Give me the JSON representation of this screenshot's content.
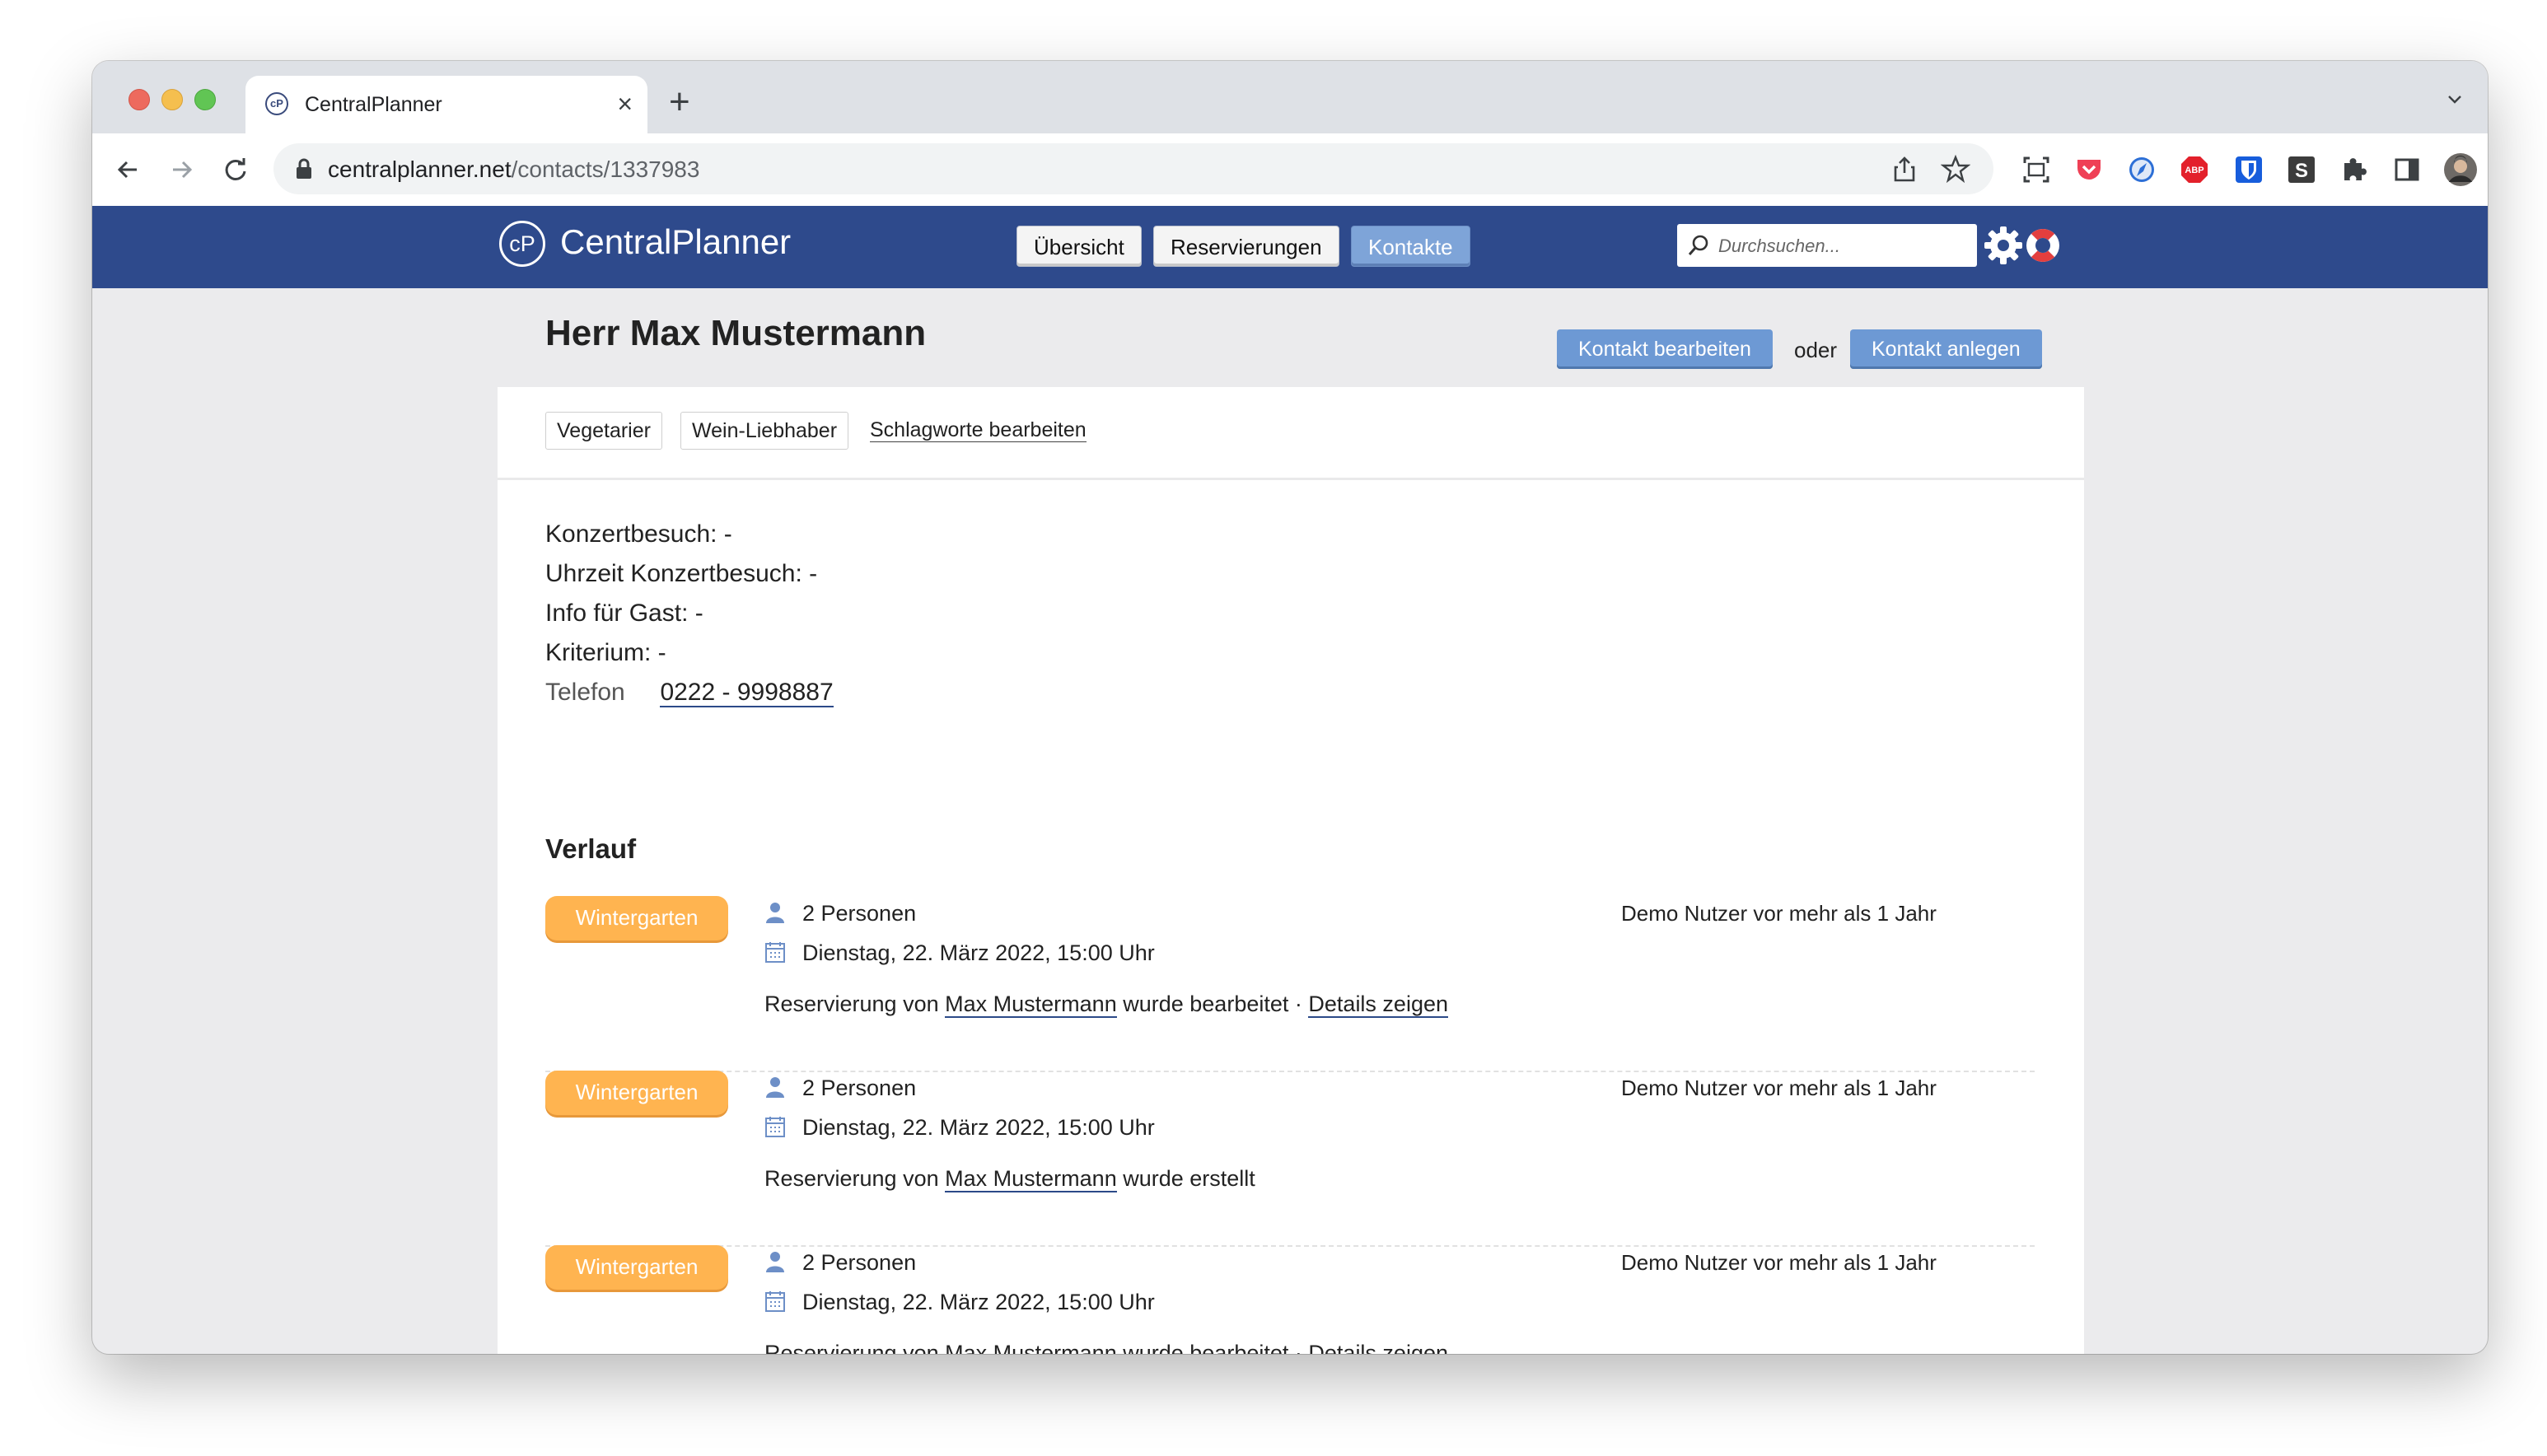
{
  "browser": {
    "tab_title": "CentralPlanner",
    "tab_favicon": "cP",
    "url_host": "centralplanner.net",
    "url_path": "/contacts/1337983",
    "extensions": [
      "share-icon",
      "bookmark-star-icon",
      "screenshot-icon",
      "pocket-icon",
      "safari-icon",
      "adblock-icon",
      "bitwarden-icon",
      "s-extension-icon",
      "puzzle-icon",
      "sidebar-icon",
      "profile-avatar",
      "more-vert-icon"
    ]
  },
  "app": {
    "logo_mark": "cP",
    "name": "CentralPlanner",
    "nav": [
      "Übersicht",
      "Reservierungen",
      "Kontakte"
    ],
    "active_nav": "Kontakte",
    "search_placeholder": "Durchsuchen...",
    "colors": {
      "header": "#2e4a8c",
      "accent": "#6d99d4",
      "badge": "#ffb450"
    }
  },
  "contact": {
    "title": "Herr Max Mustermann",
    "edit_button": "Kontakt bearbeiten",
    "or": "oder",
    "create_button": "Kontakt anlegen",
    "tags": [
      "Vegetarier",
      "Wein-Liebhaber"
    ],
    "edit_tags": "Schlagworte bearbeiten",
    "fields": [
      "Konzertbesuch: -",
      "Uhrzeit Konzertbesuch: -",
      "Info für Gast: -",
      "Kriterium: -"
    ],
    "phone_label": "Telefon",
    "phone_value": "0222 - 9998887"
  },
  "history": {
    "title": "Verlauf",
    "entries": [
      {
        "room": "Wintergarten",
        "persons": "2 Personen",
        "date": "Dienstag, 22. März 2022, 15:00 Uhr",
        "meta": "Demo Nutzer vor mehr als 1 Jahr",
        "prefix": "Reservierung von",
        "name": "Max Mustermann",
        "action": "wurde bearbeitet",
        "sep": "·",
        "details": "Details zeigen"
      },
      {
        "room": "Wintergarten",
        "persons": "2 Personen",
        "date": "Dienstag, 22. März 2022, 15:00 Uhr",
        "meta": "Demo Nutzer vor mehr als 1 Jahr",
        "prefix": "Reservierung von",
        "name": "Max Mustermann",
        "action": "wurde erstellt"
      },
      {
        "room": "Wintergarten",
        "persons": "2 Personen",
        "date": "Dienstag, 22. März 2022, 15:00 Uhr",
        "meta": "Demo Nutzer vor mehr als 1 Jahr",
        "prefix": "Reservierung von",
        "name": "Max Mustermann",
        "action": "wurde bearbeitet",
        "sep": "·",
        "details": "Details zeigen"
      }
    ]
  }
}
